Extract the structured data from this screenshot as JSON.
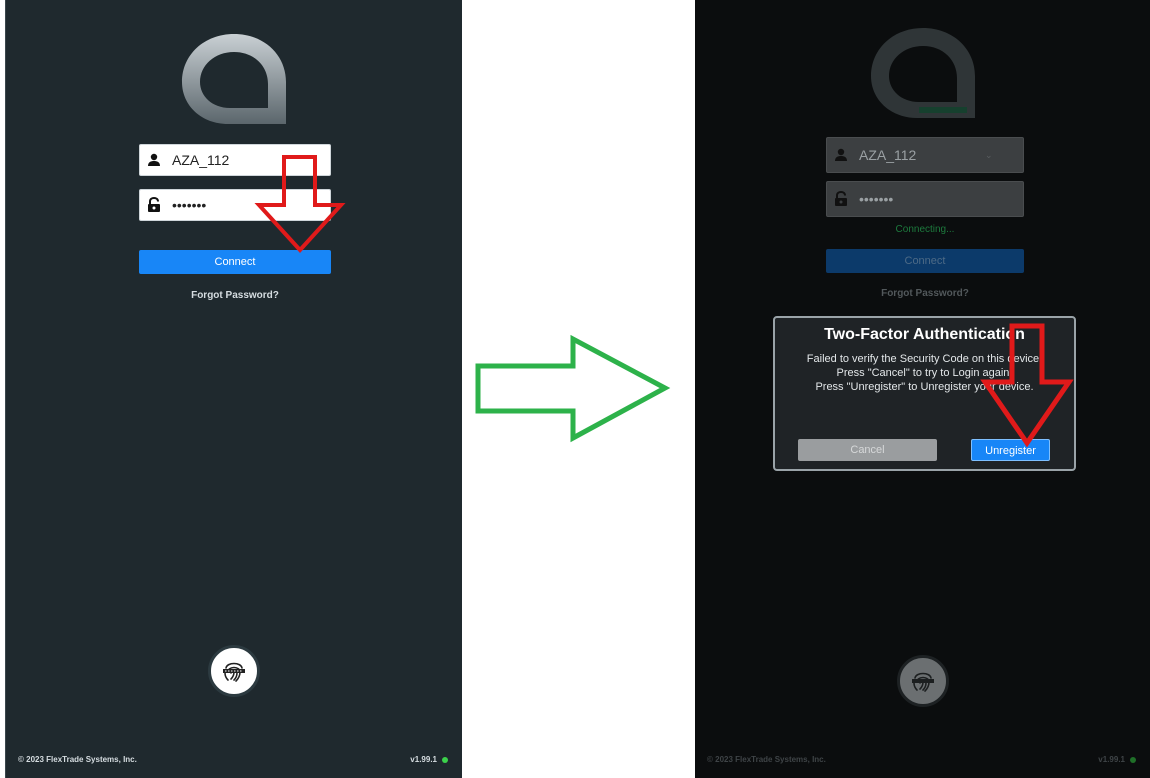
{
  "login": {
    "username_value": "AZA_112",
    "password_value": "•••••••",
    "connect_label": "Connect",
    "forgot_label": "Forgot Password?",
    "footer_copyright": "© 2023 FlexTrade Systems, Inc.",
    "version": "v1.99.1"
  },
  "connecting_status": "Connecting...",
  "dialog": {
    "title": "Two-Factor Authentication",
    "message": "Failed to verify the Security Code on this device.\nPress \"Cancel\" to try to Login again.\nPress \"Unregister\" to Unregister your device.",
    "cancel_label": "Cancel",
    "unregister_label": "Unregister"
  },
  "colors": {
    "accent": "#1886f7",
    "annotation_red": "#e01a1a",
    "annotation_green": "#2db24a",
    "status_green": "#3bd14b"
  },
  "icons": [
    "user-icon",
    "lock-icon",
    "fingerprint-icon",
    "arrow-down-annotation",
    "arrow-right-annotation"
  ]
}
